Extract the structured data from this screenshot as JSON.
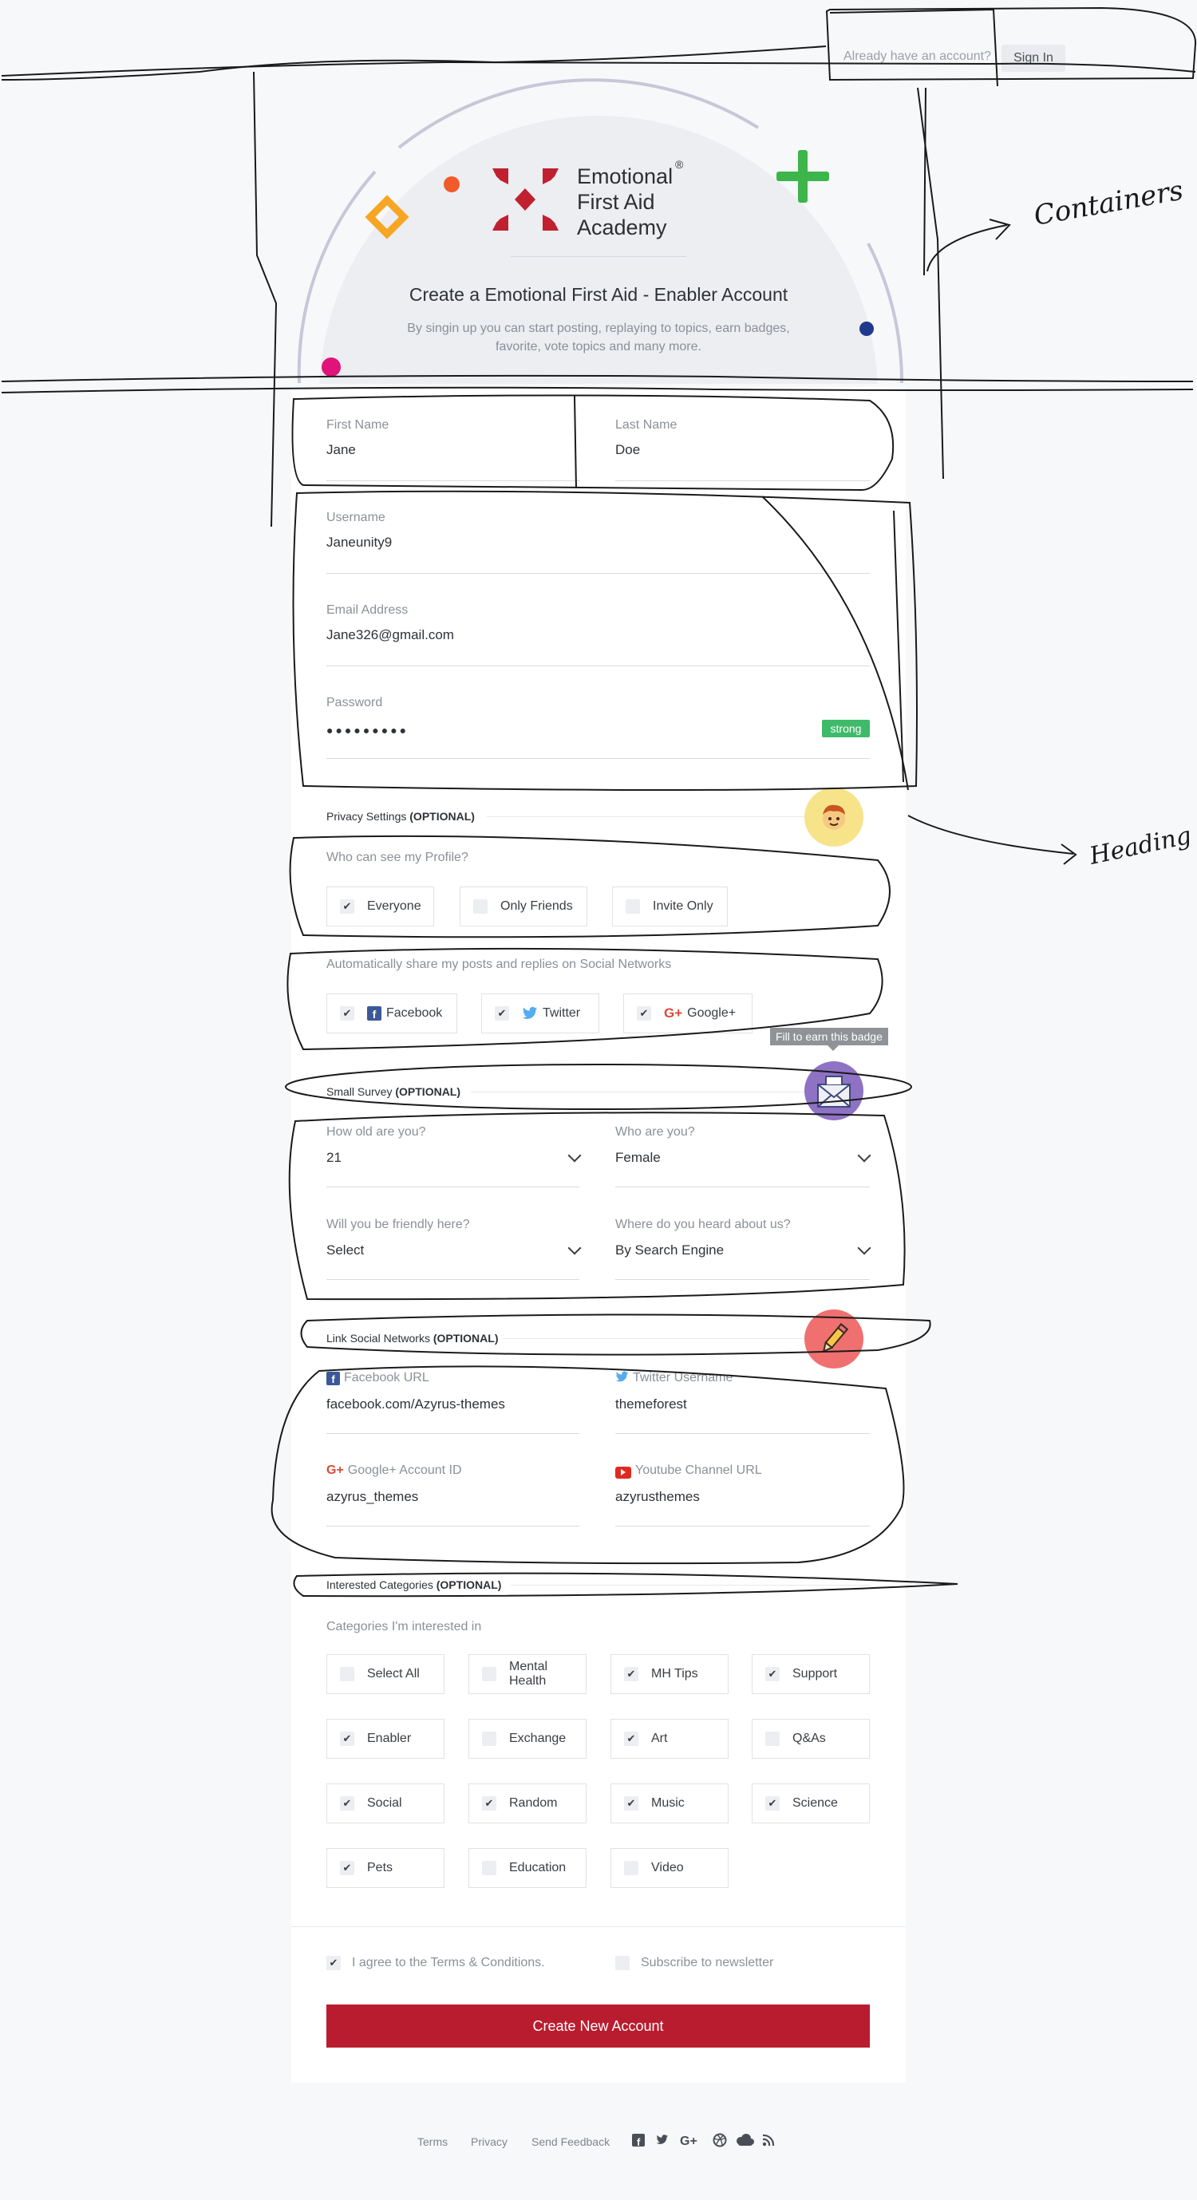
{
  "header": {
    "already_text": "Already have an account?",
    "signin_label": "Sign In"
  },
  "logo": {
    "line1": "Emotional",
    "line2": "First Aid",
    "line3": "Academy",
    "reg": "®"
  },
  "hero": {
    "title": "Create a Emotional First Aid - Enabler Account",
    "subtitle": "By singin up you can start posting, replaying to topics, earn badges, favorite, vote topics and many more."
  },
  "account": {
    "first_name_label": "First Name",
    "first_name": "Jane",
    "last_name_label": "Last Name",
    "last_name": "Doe",
    "username_label": "Username",
    "username": "Janeunity9",
    "email_label": "Email Address",
    "email": "Jane326@gmail.com",
    "password_label": "Password",
    "password_mask": "●●●●●●●●●",
    "strength": "strong"
  },
  "privacy": {
    "title": "Privacy Settings",
    "optional": "(OPTIONAL)",
    "profile_question": "Who can see my Profile?",
    "profile_options": [
      {
        "label": "Everyone",
        "checked": true
      },
      {
        "label": "Only Friends",
        "checked": false
      },
      {
        "label": "Invite Only",
        "checked": false
      }
    ],
    "share_question": "Automatically share my posts and replies on Social Networks",
    "share_options": [
      {
        "label": "Facebook",
        "checked": true,
        "icon": "facebook-icon"
      },
      {
        "label": "Twitter",
        "checked": true,
        "icon": "twitter-icon"
      },
      {
        "label": "Google+",
        "checked": true,
        "icon": "google-plus-icon"
      }
    ]
  },
  "tooltip": "Fill to earn this badge",
  "survey": {
    "title": "Small Survey",
    "optional": "(OPTIONAL)",
    "age_label": "How old are you?",
    "age_value": "21",
    "who_label": "Who are you?",
    "who_value": "Female",
    "friendly_label": "Will you be friendly here?",
    "friendly_value": "Select",
    "heard_label": "Where do you heard about us?",
    "heard_value": "By Search Engine"
  },
  "social": {
    "title": "Link Social Networks",
    "optional": "(OPTIONAL)",
    "facebook_label": "Facebook URL",
    "facebook_value": "facebook.com/Azyrus-themes",
    "twitter_label": "Twitter Username",
    "twitter_value": "themeforest",
    "google_label": "Google+ Account ID",
    "google_value": "azyrus_themes",
    "youtube_label": "Youtube Channel URL",
    "youtube_value": "azyrusthemes"
  },
  "categories": {
    "title": "Interested Categories",
    "optional": "(OPTIONAL)",
    "question": "Categories I'm interested in",
    "items": [
      {
        "label": "Select All",
        "checked": false
      },
      {
        "label": "Mental Health",
        "checked": false
      },
      {
        "label": "MH Tips",
        "checked": true
      },
      {
        "label": "Support",
        "checked": true
      },
      {
        "label": "Enabler",
        "checked": true
      },
      {
        "label": "Exchange",
        "checked": false
      },
      {
        "label": "Art",
        "checked": true
      },
      {
        "label": "Q&As",
        "checked": false
      },
      {
        "label": "Social",
        "checked": true
      },
      {
        "label": "Random",
        "checked": true
      },
      {
        "label": "Music",
        "checked": true
      },
      {
        "label": "Science",
        "checked": true
      },
      {
        "label": "Pets",
        "checked": true
      },
      {
        "label": "Education",
        "checked": false
      },
      {
        "label": "Video",
        "checked": false
      }
    ]
  },
  "agree": {
    "terms_label": "I agree to the Terms & Conditions.",
    "terms_checked": true,
    "newsletter_label": "Subscribe to newsletter",
    "newsletter_checked": false
  },
  "submit_label": "Create New Account",
  "footer": {
    "terms": "Terms",
    "privacy": "Privacy",
    "feedback": "Send Feedback",
    "icons": [
      "facebook-icon",
      "twitter-icon",
      "google-plus-icon",
      "dribbble-icon",
      "cloud-icon",
      "rss-icon"
    ]
  },
  "annotations": {
    "containers": "Containers",
    "heading": "Heading"
  },
  "colors": {
    "primary": "#b91c2e",
    "strong": "#3fba6a",
    "accent_green": "#3cb54a",
    "accent_orange": "#f6a623",
    "accent_pink": "#e0137a",
    "accent_blue": "#1f3a8c"
  }
}
